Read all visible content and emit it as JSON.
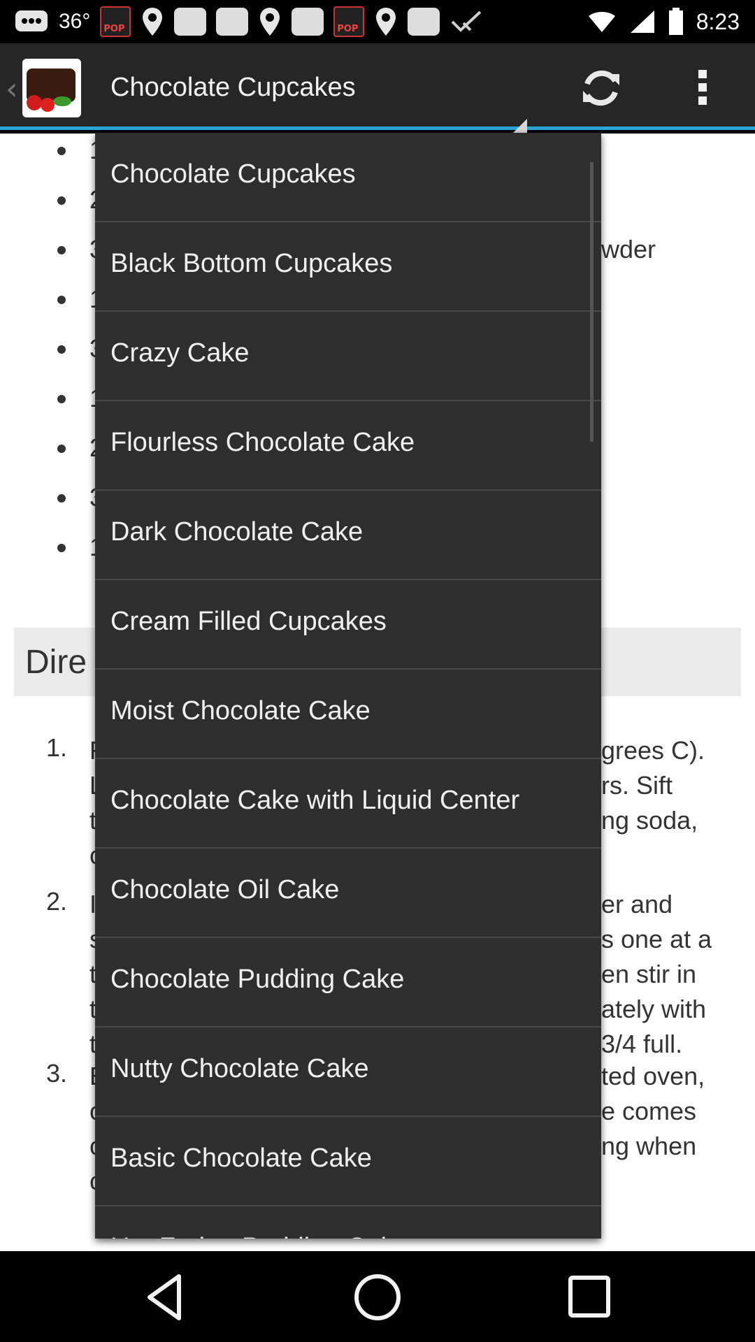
{
  "status_bar": {
    "temperature": "36°",
    "time": "8:23",
    "icons": [
      "messages-icon",
      "pop-icon",
      "location-icon",
      "square-icon",
      "square-icon",
      "location-icon",
      "square-icon",
      "pop-icon",
      "location-icon",
      "square-icon",
      "check-icon"
    ]
  },
  "action_bar": {
    "title": "Chocolate Cupcakes",
    "logo": "chocolate-cake-logo",
    "actions": [
      "refresh-icon",
      "overflow-menu-icon"
    ]
  },
  "content": {
    "ingredient_fragments": [
      "1",
      "2",
      "3",
      "1",
      "3",
      "1",
      "2",
      "3",
      "1"
    ],
    "ingredient_tail": "wder",
    "directions_header": "Dire",
    "steps": [
      {
        "num": "1.",
        "lines": [
          "F",
          "L",
          "t",
          "c"
        ],
        "tails": [
          "grees C).",
          "rs. Sift",
          "ng soda,",
          ""
        ]
      },
      {
        "num": "2.",
        "lines": [
          "I",
          "s",
          "t",
          "t",
          "t"
        ],
        "tails": [
          "er and",
          "s one at a",
          "en stir in",
          "ately with",
          "3/4 full."
        ]
      },
      {
        "num": "3.",
        "lines": [
          "E",
          "c",
          "c",
          "c"
        ],
        "tails": [
          "ted oven,",
          "e comes",
          "ng when",
          ""
        ]
      }
    ]
  },
  "dropdown": {
    "items": [
      "Chocolate Cupcakes",
      "Black Bottom Cupcakes",
      "Crazy Cake",
      "Flourless Chocolate Cake",
      "Dark Chocolate Cake",
      "Cream Filled Cupcakes",
      "Moist Chocolate Cake",
      "Chocolate Cake with Liquid Center",
      "Chocolate Oil Cake",
      "Chocolate Pudding Cake",
      "Nutty Chocolate Cake",
      "Basic Chocolate Cake",
      "Hot Fudge Pudding Cake"
    ]
  },
  "nav_bar": {
    "buttons": [
      "back-icon",
      "home-icon",
      "recents-icon"
    ]
  }
}
